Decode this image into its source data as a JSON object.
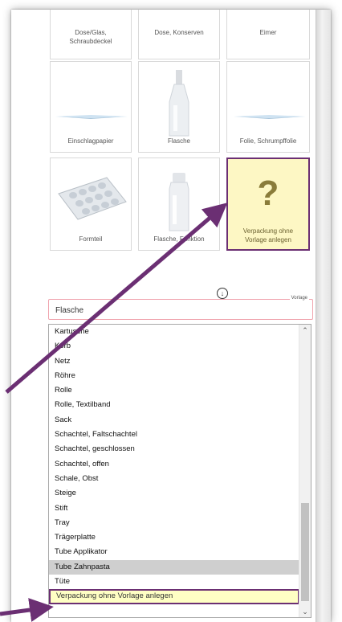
{
  "tiles": {
    "dose_glas": "Dose/Glas, Schraubdeckel",
    "dose_konserven": "Dose, Konserven",
    "eimer": "Eimer",
    "einschlagpapier": "Einschlagpapier",
    "flasche": "Flasche",
    "folie": "Folie, Schrumpffolie",
    "formteil": "Formteil",
    "flasche_funktion": "Flasche, Funktion",
    "ohne_vorlage": "Verpackung ohne Vorlage anlegen",
    "qmark": "?"
  },
  "vorlage_field": {
    "legend": "Vorlage",
    "value": "Flasche"
  },
  "list": {
    "items": [
      "Kartusche",
      "Korb",
      "Netz",
      "Röhre",
      "Rolle",
      "Rolle, Textilband",
      "Sack",
      "Schachtel, Faltschachtel",
      "Schachtel, geschlossen",
      "Schachtel, offen",
      "Schale, Obst",
      "Steige",
      "Stift",
      "Tray",
      "Trägerplatte",
      "Tube Applikator",
      "Tube Zahnpasta",
      "Tüte",
      "Verpackung ohne Vorlage anlegen"
    ],
    "selected_index": 16,
    "highlighted_index": 18
  },
  "colors": {
    "annotation_arrow": "#6b2f73",
    "highlight_fill": "#ffffc4",
    "field_border": "#f0a3ad"
  },
  "icons": {
    "down": "arrow-down-circle-icon",
    "scroll_up": "scroll-up-icon",
    "scroll_down": "scroll-down-icon"
  }
}
